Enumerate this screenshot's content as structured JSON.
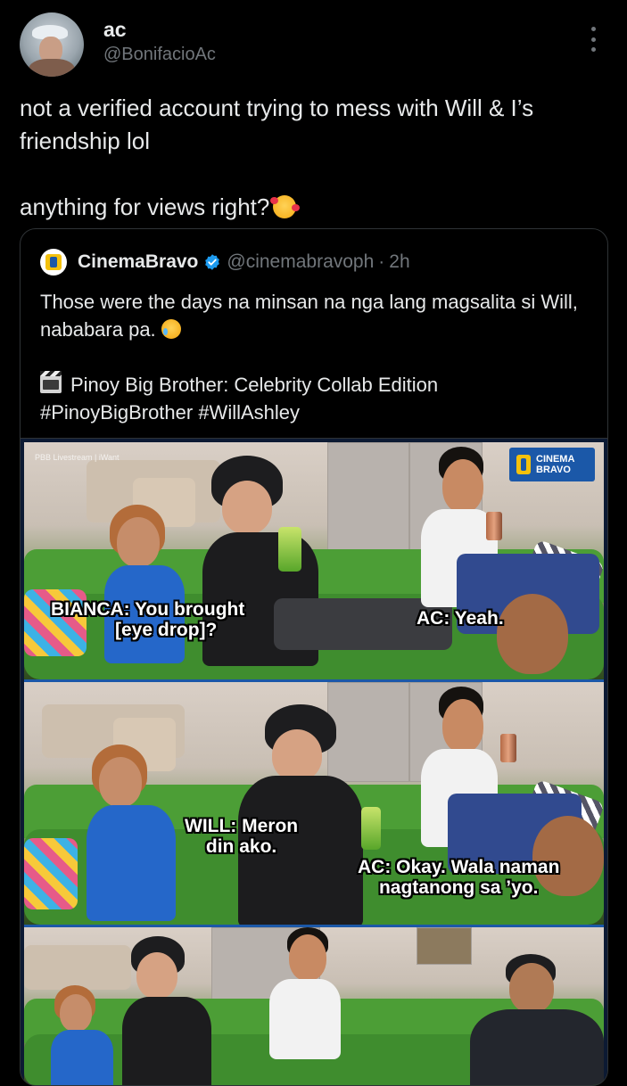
{
  "author": {
    "display_name": "ac",
    "handle": "@BonifacioAc"
  },
  "tweet": {
    "line1": "not a verified account trying to mess with Will & I’s friendship lol",
    "line2": "anything for views right?"
  },
  "quoted": {
    "display_name": "CinemaBravo",
    "handle": "@cinemabravoph",
    "separator": "·",
    "time": "2h",
    "text_line1": "Those were the days na minsan na nga lang magsalita si Will, nababara pa.",
    "text_line2": "Pinoy Big Brother: Celebrity Collab Edition",
    "text_line3": "#PinoyBigBrother #WillAshley"
  },
  "media": {
    "watermark": "PBB Livestream | iWant",
    "logo_text": [
      "CINEMA",
      "BRAVO"
    ],
    "captions": {
      "bianca_1": "BIANCA: You brought",
      "bianca_2": "[eye drop]?",
      "ac_yeah": "AC: Yeah.",
      "will_1": "WILL: Meron",
      "will_2": "din ako.",
      "ac_okay_1": "AC: Okay. Wala naman",
      "ac_okay_2": "nagtanong sa ’yo."
    }
  },
  "colors": {
    "background": "#000000",
    "text_primary": "#e7e9ea",
    "text_secondary": "#71767b",
    "verified_blue": "#1d9bf0",
    "brand_blue": "#1b58a8",
    "brand_yellow": "#f4c10d"
  },
  "icons": [
    "more-vertical-icon",
    "verified-badge-icon",
    "smiling-face-with-hearts-icon",
    "smiling-face-with-tear-icon",
    "clapper-board-icon"
  ]
}
